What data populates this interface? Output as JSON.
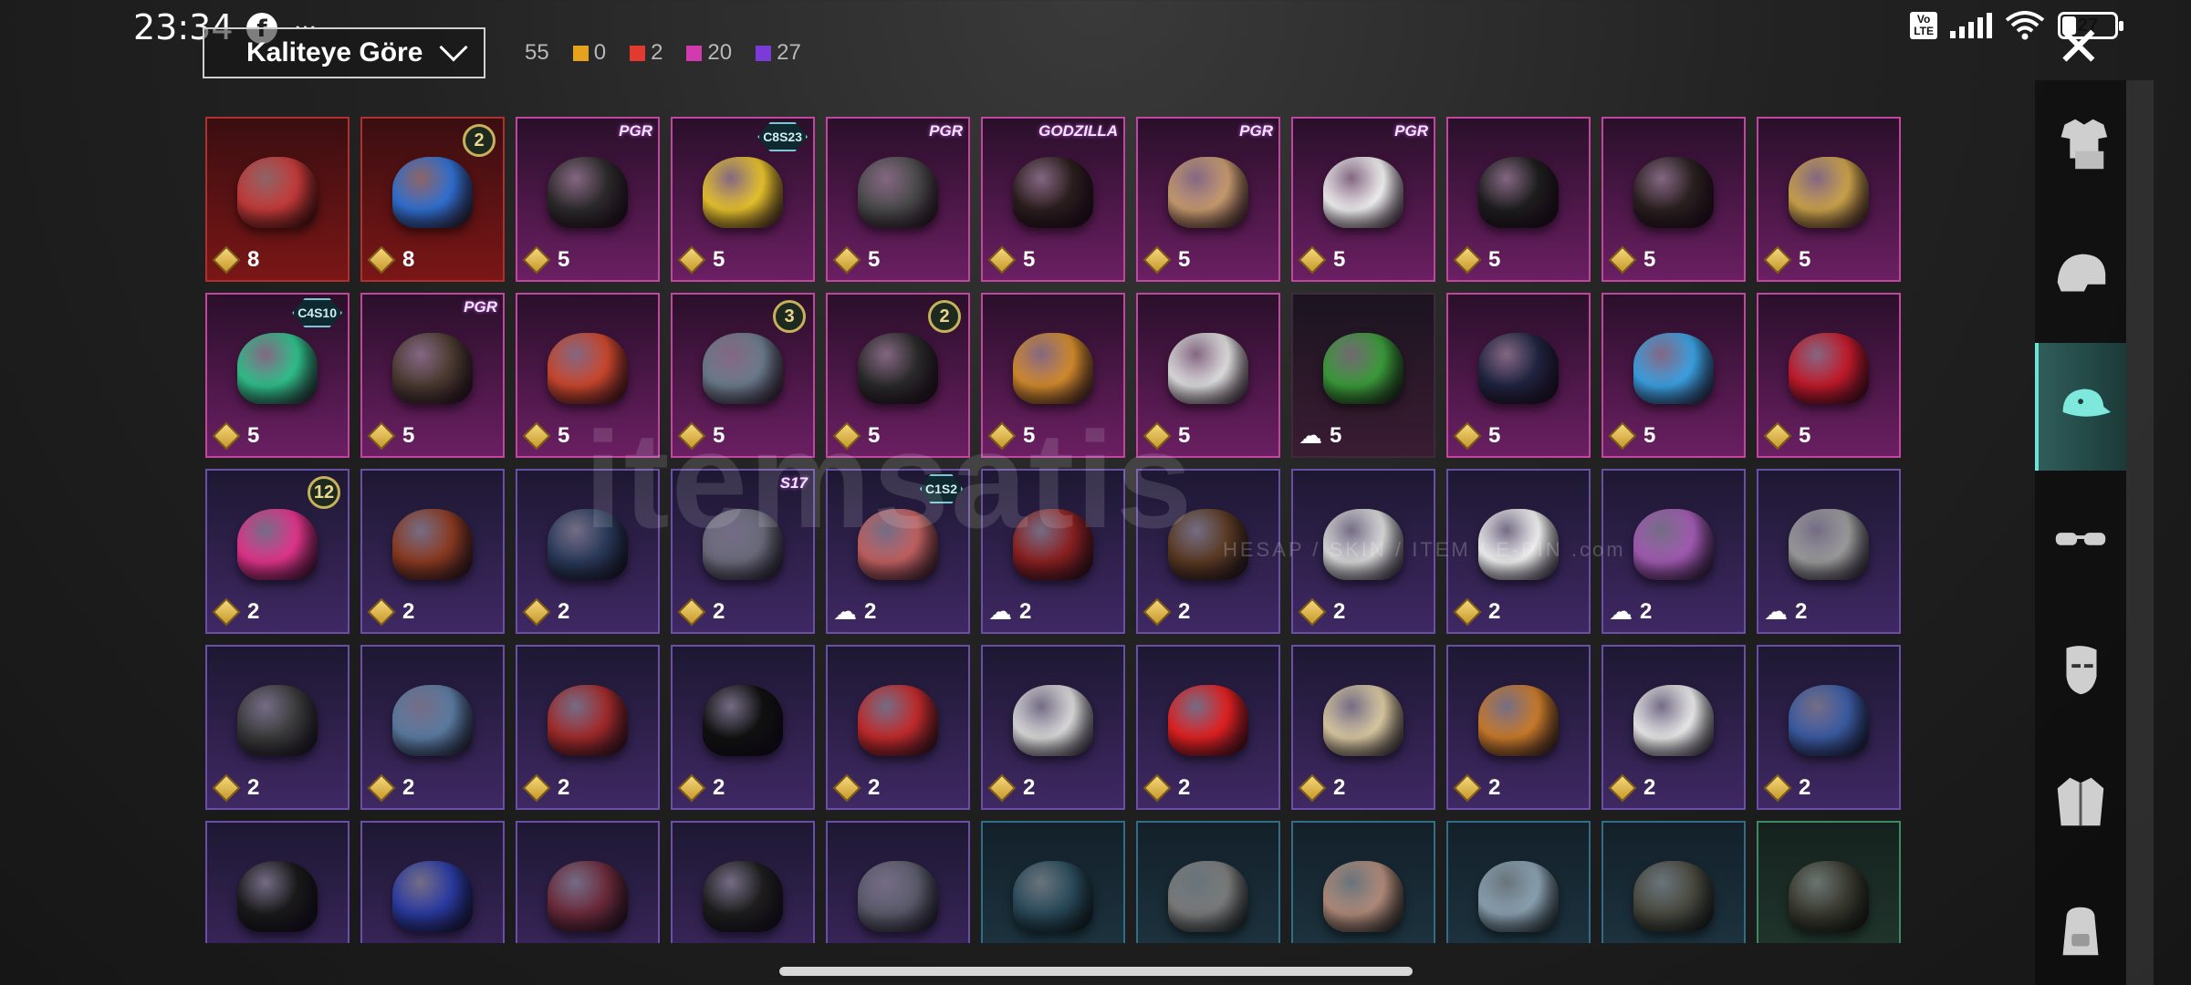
{
  "status_bar": {
    "time": "23:34",
    "ellipsis": "...",
    "volte": "Vo\nLTE",
    "battery": "27",
    "battery_level": 0.27
  },
  "sort": {
    "label": "Kaliteye Göre"
  },
  "counts": [
    {
      "value": "55",
      "color": null
    },
    {
      "value": "0",
      "color": "#e6a21c"
    },
    {
      "value": "2",
      "color": "#e23a2f"
    },
    {
      "value": "20",
      "color": "#d23bb0"
    },
    {
      "value": "27",
      "color": "#7b3bd8"
    }
  ],
  "items": [
    {
      "tier": "red",
      "price": "8",
      "color": "#c23a3a",
      "badge": null
    },
    {
      "tier": "red",
      "price": "8",
      "color": "#2f6fd0",
      "badge": {
        "type": "num",
        "text": "2"
      }
    },
    {
      "tier": "pink",
      "price": "5",
      "color": "#2c2a2a",
      "badge": {
        "type": "text",
        "text": "PGR"
      }
    },
    {
      "tier": "pink",
      "price": "5",
      "color": "#e5c22c",
      "badge": {
        "type": "hex",
        "text": "C8S23"
      }
    },
    {
      "tier": "pink",
      "price": "5",
      "color": "#4a4a4a",
      "badge": {
        "type": "text",
        "text": "PGR"
      }
    },
    {
      "tier": "pink",
      "price": "5",
      "color": "#2b1e1e",
      "badge": {
        "type": "text",
        "text": "GODZILLA"
      }
    },
    {
      "tier": "pink",
      "price": "5",
      "color": "#c59a6e",
      "badge": {
        "type": "text",
        "text": "PGR"
      }
    },
    {
      "tier": "pink",
      "price": "5",
      "color": "#eeeeee",
      "badge": {
        "type": "text",
        "text": "PGR"
      }
    },
    {
      "tier": "pink",
      "price": "5",
      "color": "#1e1e1e",
      "badge": null
    },
    {
      "tier": "pink",
      "price": "5",
      "color": "#2a2020",
      "badge": null
    },
    {
      "tier": "pink",
      "price": "5",
      "color": "#c9a24a",
      "badge": null
    },
    {
      "tier": "pink",
      "price": "5",
      "color": "#2fbf8a",
      "badge": {
        "type": "hex",
        "text": "C4S10"
      }
    },
    {
      "tier": "pink",
      "price": "5",
      "color": "#4a3a30",
      "badge": {
        "type": "text",
        "text": "PGR"
      }
    },
    {
      "tier": "pink",
      "price": "5",
      "color": "#c8472c",
      "badge": null
    },
    {
      "tier": "pink",
      "price": "5",
      "color": "#6a7a8a",
      "badge": {
        "type": "num",
        "text": "3"
      }
    },
    {
      "tier": "pink",
      "price": "5",
      "color": "#2a2a2a",
      "badge": {
        "type": "num",
        "text": "2"
      }
    },
    {
      "tier": "pink",
      "price": "5",
      "color": "#d08a2c",
      "badge": null
    },
    {
      "tier": "pink",
      "price": "5",
      "color": "#dcdcdc",
      "badge": null
    },
    {
      "tier": "dim",
      "price": "5",
      "color": "#3a9a3a",
      "badge": null,
      "cloud": true
    },
    {
      "tier": "pink",
      "price": "5",
      "color": "#1f2440",
      "badge": null
    },
    {
      "tier": "pink",
      "price": "5",
      "color": "#3aa0e0",
      "badge": null
    },
    {
      "tier": "pink",
      "price": "5",
      "color": "#c01a2a",
      "badge": null
    },
    {
      "tier": "purple",
      "price": "2",
      "color": "#e0348a",
      "badge": {
        "type": "num",
        "text": "12"
      }
    },
    {
      "tier": "purple",
      "price": "2",
      "color": "#8a3a20",
      "badge": null
    },
    {
      "tier": "purple",
      "price": "2",
      "color": "#2a3a5a",
      "badge": null
    },
    {
      "tier": "purple",
      "price": "2",
      "color": "#6a6a7a",
      "badge": {
        "type": "text",
        "text": "S17"
      }
    },
    {
      "tier": "purple",
      "price": "2",
      "color": "#c06060",
      "badge": {
        "type": "hex",
        "text": "C1S2"
      },
      "cloud": true
    },
    {
      "tier": "purple",
      "price": "2",
      "color": "#8a2020",
      "badge": null,
      "cloud": true
    },
    {
      "tier": "purple",
      "price": "2",
      "color": "#5a3a22",
      "badge": null
    },
    {
      "tier": "purple",
      "price": "2",
      "color": "#d8d8d8",
      "badge": null
    },
    {
      "tier": "purple",
      "price": "2",
      "color": "#f0f0f0",
      "badge": null
    },
    {
      "tier": "purple",
      "price": "2",
      "color": "#a05ab0",
      "badge": null,
      "cloud": true
    },
    {
      "tier": "purple",
      "price": "2",
      "color": "#9a9a9a",
      "badge": null,
      "cloud": true
    },
    {
      "tier": "purple",
      "price": "2",
      "color": "#3a3a3a",
      "badge": null
    },
    {
      "tier": "purple",
      "price": "2",
      "color": "#5a7aa0",
      "badge": null
    },
    {
      "tier": "purple",
      "price": "2",
      "color": "#a02a2a",
      "badge": null
    },
    {
      "tier": "purple",
      "price": "2",
      "color": "#111111",
      "badge": null
    },
    {
      "tier": "purple",
      "price": "2",
      "color": "#c02a2a",
      "badge": null
    },
    {
      "tier": "purple",
      "price": "2",
      "color": "#d8d8d8",
      "badge": null
    },
    {
      "tier": "purple",
      "price": "2",
      "color": "#e02020",
      "badge": null
    },
    {
      "tier": "purple",
      "price": "2",
      "color": "#d8c8a0",
      "badge": null
    },
    {
      "tier": "purple",
      "price": "2",
      "color": "#c87a2a",
      "badge": null
    },
    {
      "tier": "purple",
      "price": "2",
      "color": "#e8e8e8",
      "badge": null
    },
    {
      "tier": "purple",
      "price": "2",
      "color": "#3a5aa0",
      "badge": null
    },
    {
      "tier": "purple",
      "price": "",
      "color": "#1a1a1a",
      "badge": null
    },
    {
      "tier": "purple",
      "price": "",
      "color": "#2a3aa0",
      "badge": null
    },
    {
      "tier": "purple",
      "price": "",
      "color": "#6a2a3a",
      "badge": null
    },
    {
      "tier": "purple",
      "price": "",
      "color": "#1e1e1e",
      "badge": null
    },
    {
      "tier": "purple",
      "price": "",
      "color": "#5a5a6a",
      "badge": null
    },
    {
      "tier": "blue",
      "price": "",
      "color": "#2a4a5a",
      "badge": null
    },
    {
      "tier": "blue",
      "price": "",
      "color": "#7a7a7a",
      "badge": null
    },
    {
      "tier": "blue",
      "price": "",
      "color": "#b08a7a",
      "badge": null
    },
    {
      "tier": "blue",
      "price": "",
      "color": "#8aa0b0",
      "badge": null
    },
    {
      "tier": "blue",
      "price": "",
      "color": "#4a4a40",
      "badge": null
    },
    {
      "tier": "green",
      "price": "",
      "color": "#3a3a30",
      "badge": null
    }
  ],
  "watermark": {
    "brand": "itemsatis",
    "sub": "HESAP / SKIN / ITEM / E-PIN .com"
  },
  "sidebar": [
    {
      "name": "outfit-icon",
      "active": false
    },
    {
      "name": "helmet-icon",
      "active": false
    },
    {
      "name": "cap-icon",
      "active": true
    },
    {
      "name": "glasses-icon",
      "active": false
    },
    {
      "name": "mask-icon",
      "active": false
    },
    {
      "name": "jacket-icon",
      "active": false
    },
    {
      "name": "backpack-icon",
      "active": false
    }
  ]
}
